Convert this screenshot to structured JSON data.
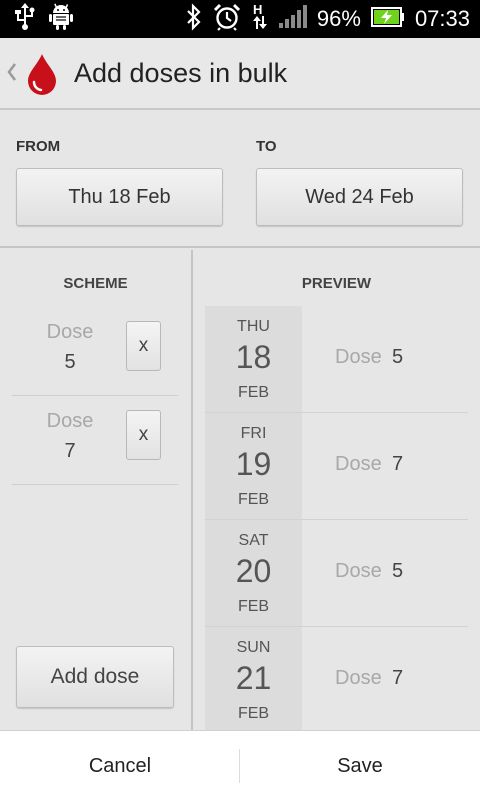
{
  "status_bar": {
    "battery_percent": "96%",
    "time": "07:33",
    "icons": [
      "usb-icon",
      "android-debug-icon",
      "bluetooth-icon",
      "alarm-icon",
      "hspa-data-icon",
      "signal-icon",
      "battery-charging-icon"
    ]
  },
  "action_bar": {
    "title": "Add doses in bulk",
    "app_icon": "blood-drop-icon",
    "accent": "#c8101b"
  },
  "range": {
    "from_label": "FROM",
    "to_label": "TO",
    "from_value": "Thu 18 Feb",
    "to_value": "Wed 24 Feb"
  },
  "scheme": {
    "title": "SCHEME",
    "items": [
      {
        "label": "Dose",
        "value": "5",
        "remove": "x"
      },
      {
        "label": "Dose",
        "value": "7",
        "remove": "x"
      }
    ],
    "add_label": "Add dose"
  },
  "preview": {
    "title": "PREVIEW",
    "rows": [
      {
        "dow": "THU",
        "day": "18",
        "month": "FEB",
        "label": "Dose",
        "value": "5"
      },
      {
        "dow": "FRI",
        "day": "19",
        "month": "FEB",
        "label": "Dose",
        "value": "7"
      },
      {
        "dow": "SAT",
        "day": "20",
        "month": "FEB",
        "label": "Dose",
        "value": "5"
      },
      {
        "dow": "SUN",
        "day": "21",
        "month": "FEB",
        "label": "Dose",
        "value": "7"
      }
    ]
  },
  "bottom_bar": {
    "cancel": "Cancel",
    "save": "Save"
  }
}
